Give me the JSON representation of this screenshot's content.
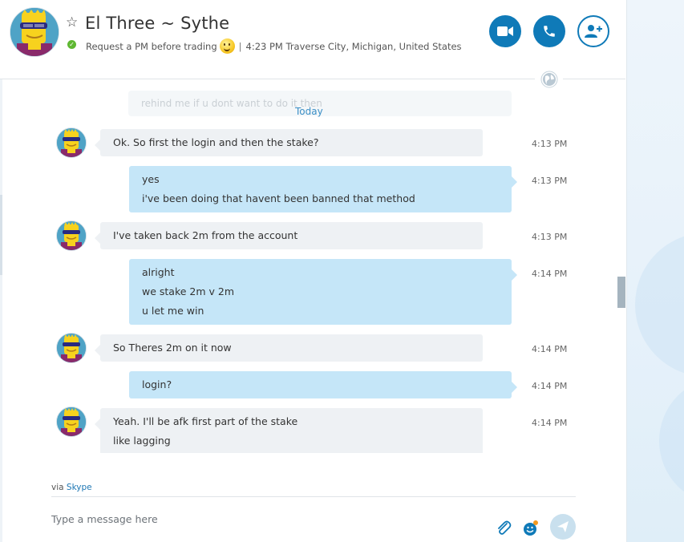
{
  "contact": {
    "name": "El Three ~ Sythe",
    "mood": "Request a PM before trading",
    "separator": "|",
    "local_time_location": "4:23 PM Traverse City, Michigan, United States"
  },
  "header_buttons": {
    "video_call": "video-camera-icon",
    "voice_call": "phone-icon",
    "add_contact": "add-person-icon"
  },
  "conversation": {
    "faded_text": "rehind me if u dont want to do it then",
    "date_divider": "Today",
    "messages": [
      {
        "direction": "in",
        "lines": [
          "Ok. So first the login and then the stake?"
        ],
        "time": "4:13 PM"
      },
      {
        "direction": "out",
        "lines": [
          "yes",
          "i've been doing that havent been banned that method"
        ],
        "time": "4:13 PM"
      },
      {
        "direction": "in",
        "lines": [
          "I've taken back 2m from the account"
        ],
        "time": "4:13 PM"
      },
      {
        "direction": "out",
        "lines": [
          "alright",
          "we stake 2m v 2m",
          "u let me win"
        ],
        "time": "4:14 PM"
      },
      {
        "direction": "in",
        "lines": [
          "So Theres 2m on it now"
        ],
        "time": "4:14 PM"
      },
      {
        "direction": "out",
        "lines": [
          "login?"
        ],
        "time": "4:14 PM"
      },
      {
        "direction": "in",
        "lines": [
          "Yeah. I'll be afk first part of the stake",
          "like lagging"
        ],
        "time": "4:14 PM"
      }
    ]
  },
  "compose": {
    "via_prefix": "via",
    "via_service": "Skype",
    "placeholder": "Type a message here"
  },
  "colors": {
    "accent": "#0f7ab8",
    "incoming_bubble": "#eef1f4",
    "outgoing_bubble": "#c5e6f8",
    "link": "#3b8fc6",
    "status_online": "#5fb832"
  }
}
